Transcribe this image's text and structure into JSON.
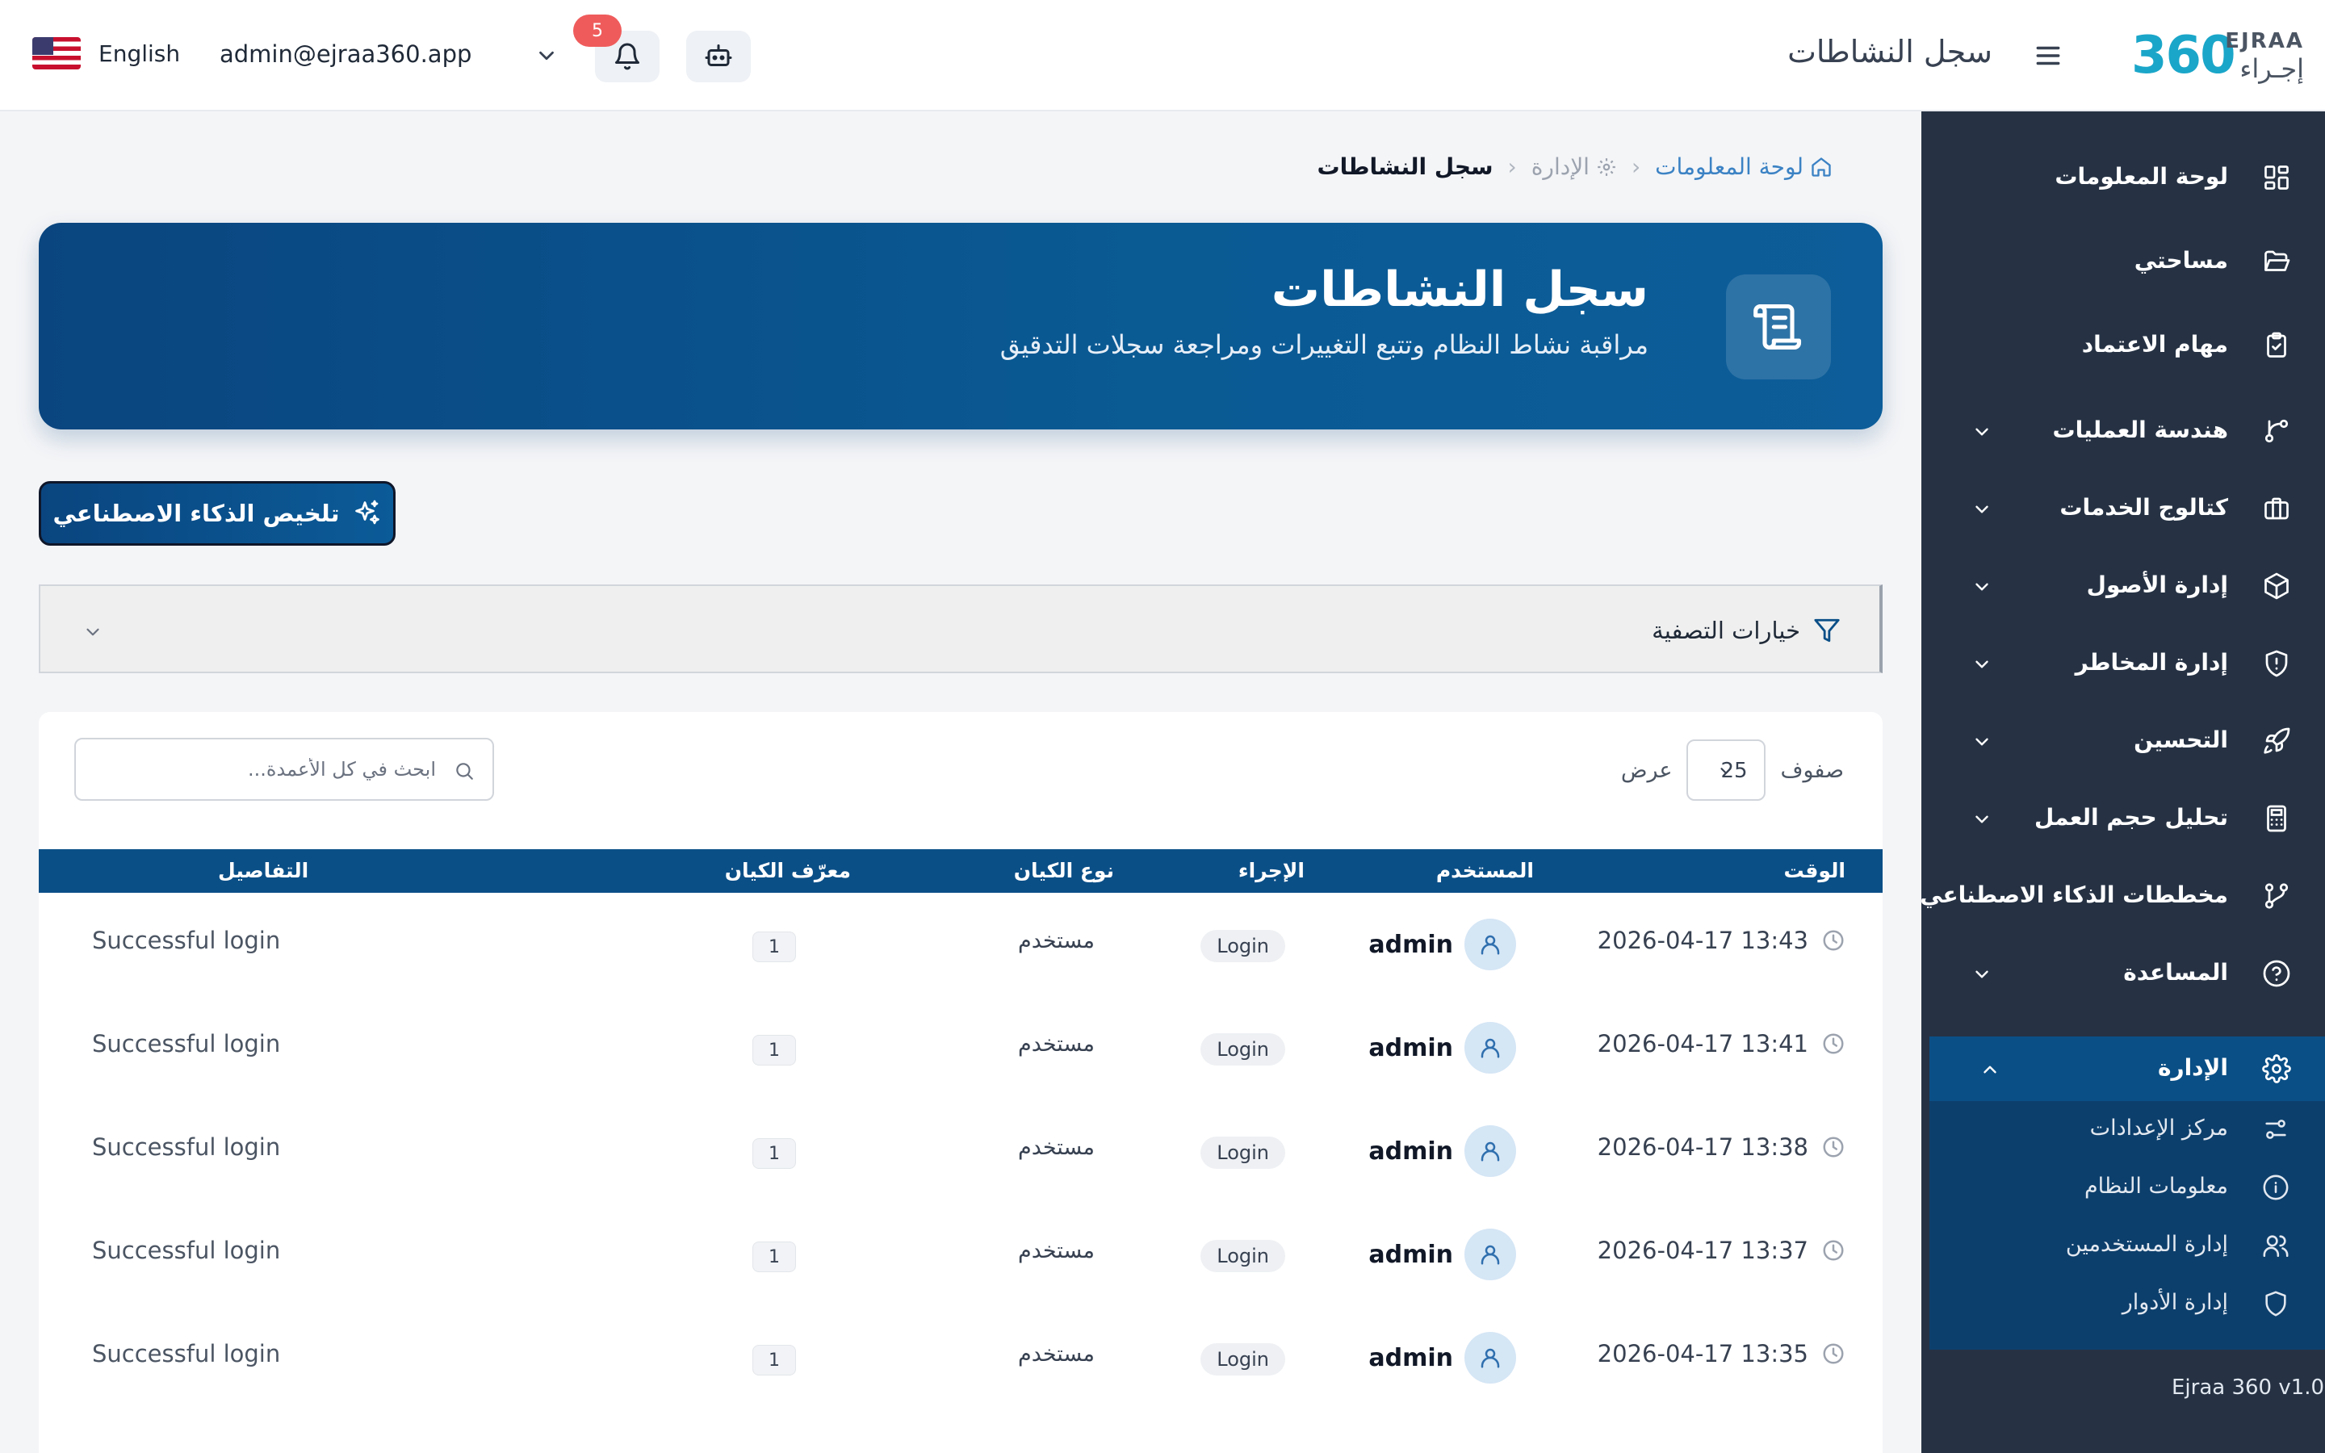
{
  "topbar": {
    "language": "English",
    "user_email": "admin@ejraa360.app",
    "notification_count": "5",
    "page_heading": "سجل النشاطات",
    "logo": {
      "number": "360",
      "latin": "EJRAA",
      "arabic": "إجـراء"
    }
  },
  "sidebar": {
    "items": [
      {
        "label": "لوحة المعلومات",
        "icon": "dashboard-grid-icon",
        "has_chevron": false
      },
      {
        "label": "مساحتي",
        "icon": "folder-open-icon",
        "has_chevron": false
      },
      {
        "label": "مهام الاعتماد",
        "icon": "clipboard-check-icon",
        "has_chevron": false
      },
      {
        "label": "هندسة العمليات",
        "icon": "git-branch-icon",
        "has_chevron": true
      },
      {
        "label": "كتالوج الخدمات",
        "icon": "briefcase-icon",
        "has_chevron": true
      },
      {
        "label": "إدارة الأصول",
        "icon": "cube-icon",
        "has_chevron": true
      },
      {
        "label": "إدارة المخاطر",
        "icon": "shield-alert-icon",
        "has_chevron": true
      },
      {
        "label": "التحسين",
        "icon": "rocket-icon",
        "has_chevron": true
      },
      {
        "label": "تحليل حجم العمل",
        "icon": "calculator-icon",
        "has_chevron": true
      },
      {
        "label": "مخططات الذكاء الاصطناعي",
        "icon": "ai-workflow-icon",
        "has_chevron": false
      },
      {
        "label": "المساعدة",
        "icon": "help-circle-icon",
        "has_chevron": true
      },
      {
        "label": "الإدارة",
        "icon": "gear-icon",
        "has_chevron": true,
        "active": true
      }
    ],
    "submenu": [
      {
        "label": "مركز الإعدادات",
        "icon": "sliders-icon"
      },
      {
        "label": "معلومات النظام",
        "icon": "info-circle-icon"
      },
      {
        "label": "إدارة المستخدمين",
        "icon": "users-icon"
      },
      {
        "label": "إدارة الأدوار",
        "icon": "shield-icon"
      }
    ],
    "version": "Ejraa 360 v1.0"
  },
  "breadcrumb": {
    "home": "لوحة المعلومات",
    "admin": "الإدارة",
    "current": "سجل النشاطات"
  },
  "hero": {
    "title": "سجل النشاطات",
    "subtitle": "مراقبة نشاط النظام وتتبع التغييرات ومراجعة سجلات التدقيق"
  },
  "ai_summary_button": "تلخيص الذكاء الاصطناعي",
  "filter": {
    "title": "خيارات التصفية"
  },
  "table": {
    "show_label": "عرض",
    "rows_value": "25",
    "rows_label": "صفوف",
    "search_placeholder": "ابحث في كل الأعمدة...",
    "columns": {
      "time": "الوقت",
      "user": "المستخدم",
      "action": "الإجراء",
      "entity_type": "نوع الكيان",
      "entity_id": "معرّف الكيان",
      "details": "التفاصيل"
    },
    "rows": [
      {
        "time": "2026-04-17 13:43",
        "user": "admin",
        "action": "Login",
        "entity_type": "مستخدم",
        "entity_id": "1",
        "details": "Successful login"
      },
      {
        "time": "2026-04-17 13:41",
        "user": "admin",
        "action": "Login",
        "entity_type": "مستخدم",
        "entity_id": "1",
        "details": "Successful login"
      },
      {
        "time": "2026-04-17 13:38",
        "user": "admin",
        "action": "Login",
        "entity_type": "مستخدم",
        "entity_id": "1",
        "details": "Successful login"
      },
      {
        "time": "2026-04-17 13:37",
        "user": "admin",
        "action": "Login",
        "entity_type": "مستخدم",
        "entity_id": "1",
        "details": "Successful login"
      },
      {
        "time": "2026-04-17 13:35",
        "user": "admin",
        "action": "Login",
        "entity_type": "مستخدم",
        "entity_id": "1",
        "details": "Successful login"
      }
    ]
  }
}
